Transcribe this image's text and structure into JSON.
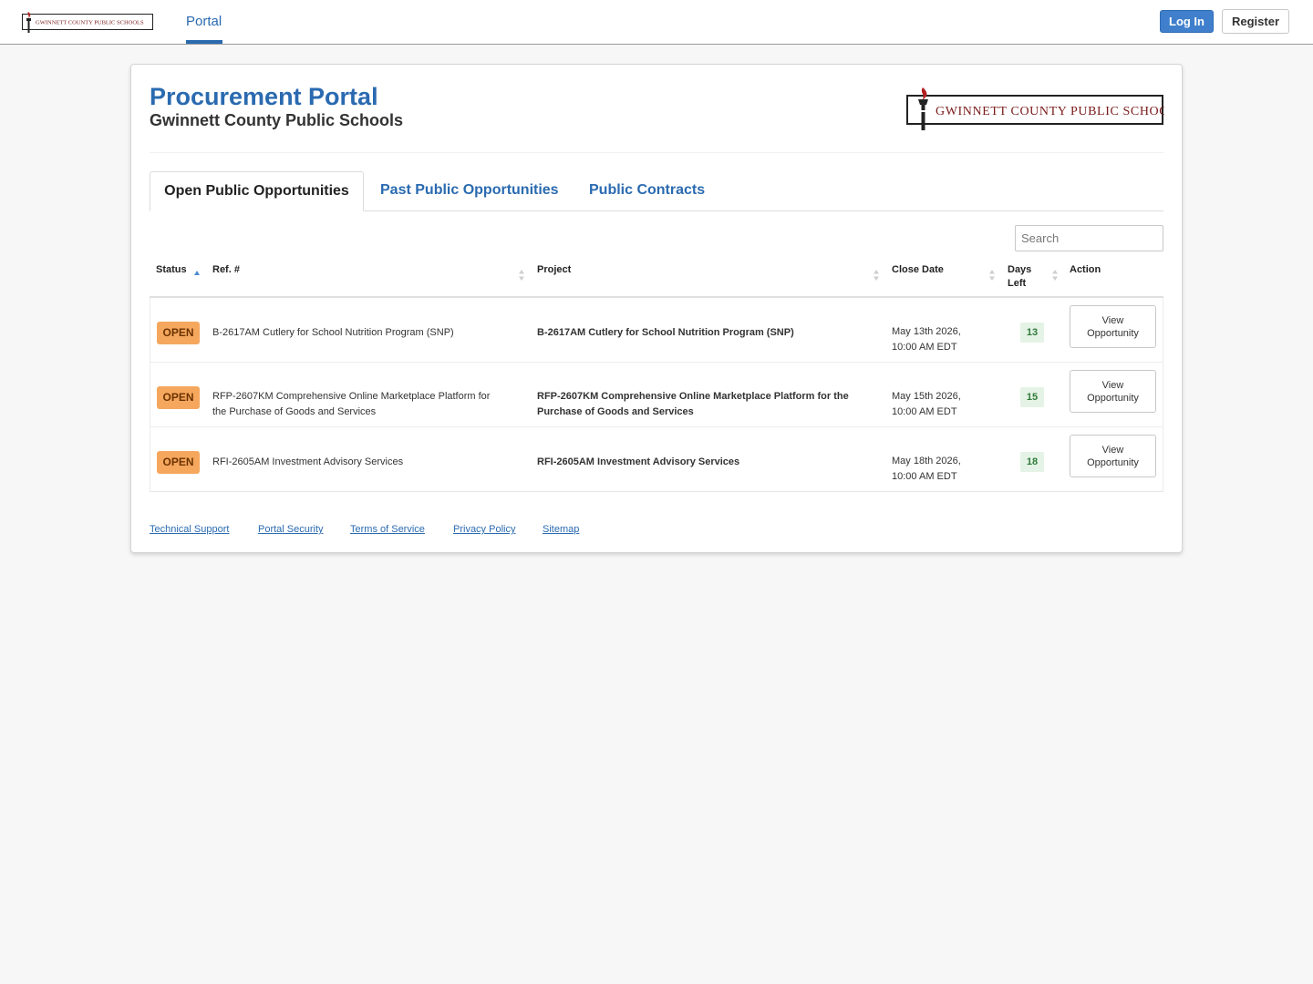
{
  "nav": {
    "logo_text": "GWINNETT COUNTY PUBLIC SCHOOLS",
    "tab_portal": "Portal",
    "login_label": "Log In",
    "register_label": "Register"
  },
  "header": {
    "title": "Procurement Portal",
    "subtitle": "Gwinnett County Public Schools",
    "logo_text": "GWINNETT COUNTY PUBLIC SCHOOLS"
  },
  "tabs": [
    {
      "label": "Open Public Opportunities"
    },
    {
      "label": "Past Public Opportunities"
    },
    {
      "label": "Public Contracts"
    }
  ],
  "search": {
    "placeholder": "Search"
  },
  "table": {
    "columns": {
      "status": "Status",
      "ref": "Ref. #",
      "project": "Project",
      "close_date": "Close Date",
      "days_left_1": "Days",
      "days_left_2": "Left",
      "action": "Action"
    },
    "rows": [
      {
        "status": "OPEN",
        "ref_line1": "B-2617AM Cutlery for School Nutrition Program (SNP)",
        "ref_line2": "",
        "project_line1": "B-2617AM Cutlery for School Nutrition Program (SNP)",
        "project_line2": "",
        "date_line1": "May 13th 2026,",
        "date_line2": "10:00 AM EDT",
        "days_left": "13",
        "action_line1": "View",
        "action_line2": "Opportunity"
      },
      {
        "status": "OPEN",
        "ref_line1": "RFP-2607KM Comprehensive Online Marketplace Platform for",
        "ref_line2": "the Purchase of Goods and Services",
        "project_line1": "RFP-2607KM Comprehensive Online Marketplace Platform for the",
        "project_line2": "Purchase of Goods and Services",
        "date_line1": "May 15th 2026,",
        "date_line2": "10:00 AM EDT",
        "days_left": "15",
        "action_line1": "View",
        "action_line2": "Opportunity"
      },
      {
        "status": "OPEN",
        "ref_line1": "RFI-2605AM Investment Advisory Services",
        "ref_line2": "",
        "project_line1": "RFI-2605AM Investment Advisory Services",
        "project_line2": "",
        "date_line1": "May 18th 2026,",
        "date_line2": "10:00 AM EDT",
        "days_left": "18",
        "action_line1": "View",
        "action_line2": "Opportunity"
      }
    ]
  },
  "footer": {
    "links": [
      "Technical Support",
      "Portal Security",
      "Terms of Service",
      "Privacy Policy",
      "Sitemap"
    ]
  },
  "colors": {
    "accent": "#2a6ab0",
    "login_bg": "#3f7fcc",
    "open_badge": "#f6a75e",
    "days_badge_bg": "#e4f3e5",
    "days_badge_text": "#2f7a3a",
    "logo_maroon": "#7a1a1a"
  }
}
